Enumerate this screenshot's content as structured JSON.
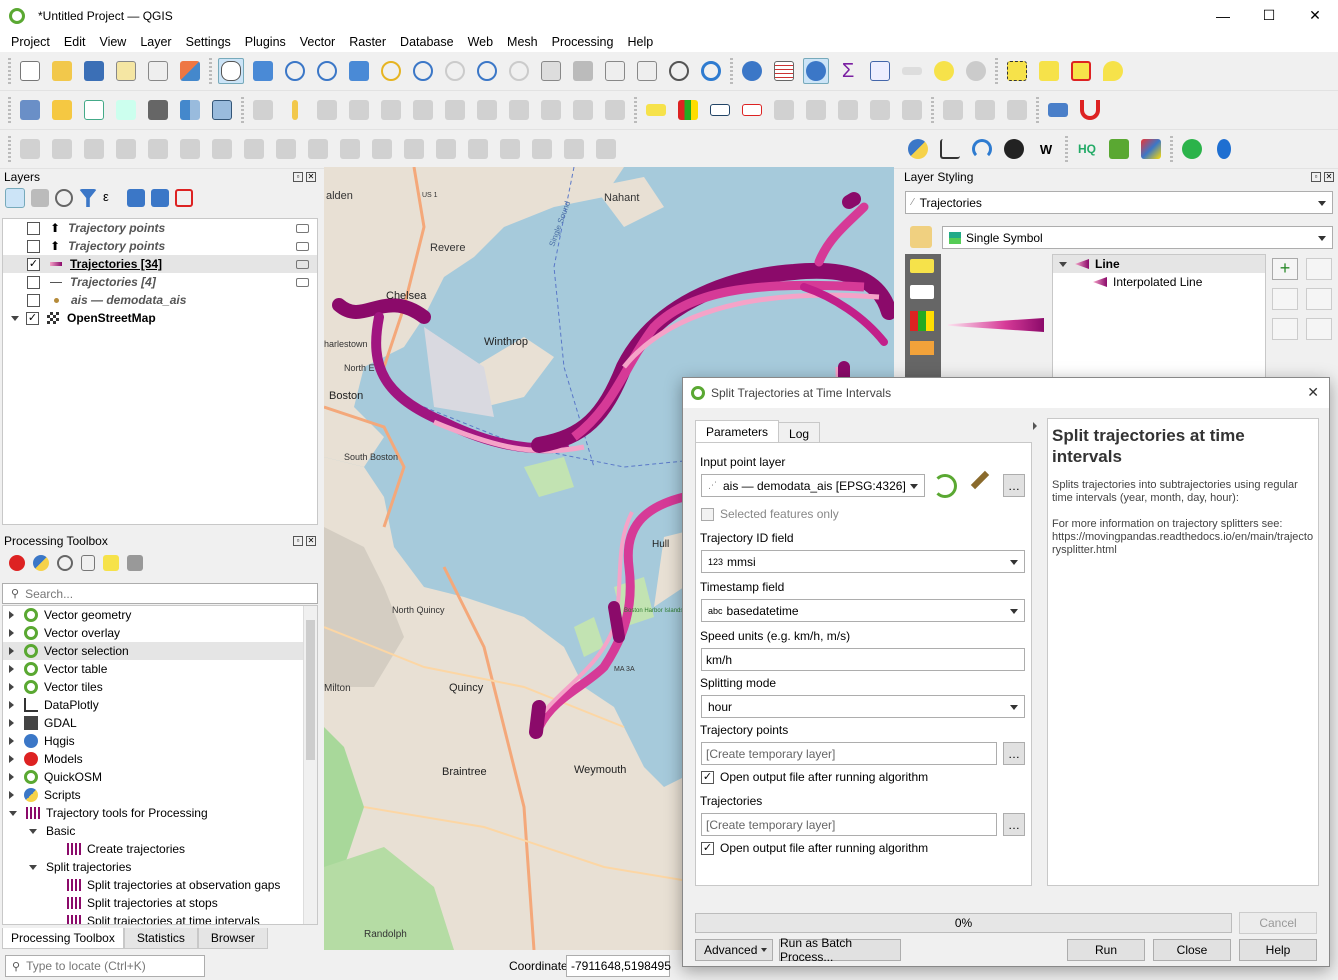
{
  "window": {
    "title": "*Untitled Project — QGIS",
    "minimize": "—",
    "maximize": "☐",
    "close": "✕"
  },
  "menu": [
    "Project",
    "Edit",
    "View",
    "Layer",
    "Settings",
    "Plugins",
    "Vector",
    "Raster",
    "Database",
    "Web",
    "Mesh",
    "Processing",
    "Help"
  ],
  "layers_panel": {
    "title": "Layers",
    "items": [
      {
        "label": "Trajectory points",
        "checked": false,
        "style": "italic"
      },
      {
        "label": "Trajectory points",
        "checked": false,
        "style": "italic"
      },
      {
        "label": "Trajectories [34]",
        "checked": true,
        "style": "boldu"
      },
      {
        "label": "Trajectories [4]",
        "checked": false,
        "style": "italic"
      },
      {
        "label": "ais — demodata_ais",
        "checked": false,
        "style": "italic"
      },
      {
        "label": "OpenStreetMap",
        "checked": true,
        "style": "bold"
      }
    ]
  },
  "toolbox": {
    "title": "Processing Toolbox",
    "search_placeholder": "Search...",
    "items": [
      "Vector geometry",
      "Vector overlay",
      "Vector selection",
      "Vector table",
      "Vector tiles",
      "DataPlotly",
      "GDAL",
      "Hqgis",
      "Models",
      "QuickOSM",
      "Scripts",
      "Trajectory tools for Processing"
    ],
    "basic": "Basic",
    "create": "Create trajectories",
    "split": "Split trajectories",
    "split_items": [
      "Split trajectories at observation gaps",
      "Split trajectories at stops",
      "Split trajectories at time intervals"
    ],
    "tabs": [
      "Processing Toolbox",
      "Statistics",
      "Browser"
    ]
  },
  "locator": {
    "placeholder": "Type to locate (Ctrl+K)"
  },
  "status": {
    "coord_label": "Coordinate",
    "coord_value": "-7911648,5198495"
  },
  "styling": {
    "title": "Layer Styling",
    "layer": "Trajectories",
    "renderer": "Single Symbol",
    "line": "Line",
    "interp": "Interpolated Line"
  },
  "map_labels": {
    "chelsea": "Chelsea",
    "revere": "Revere",
    "winthrop": "Winthrop",
    "boston": "Boston",
    "south_boston": "South Boston",
    "quincy": "Quincy",
    "north_quincy": "North Quincy",
    "milton": "Milton",
    "braintree": "Braintree",
    "weymouth": "Weymouth",
    "randolph": "Randolph",
    "hull": "Hull",
    "nahant": "Nahant",
    "malden": "alden",
    "charlestown": "harlestown",
    "north_end": "North E",
    "single_sound": "Single Sound",
    "islands": "Boston Harbor Islands National Recreation Area",
    "us1": "US 1",
    "ma3a": "MA 3A"
  },
  "dialog": {
    "title": "Split Trajectories at Time Intervals",
    "tab_params": "Parameters",
    "tab_log": "Log",
    "input_label": "Input point layer",
    "input_value": "ais — demodata_ais [EPSG:4326]",
    "selected_only": "Selected features only",
    "traj_id_label": "Trajectory ID field",
    "traj_id_value": "mmsi",
    "traj_id_prefix": "123",
    "ts_label": "Timestamp field",
    "ts_value": "basedatetime",
    "ts_prefix": "abc",
    "speed_label": "Speed units (e.g. km/h, m/s)",
    "speed_value": "km/h",
    "mode_label": "Splitting mode",
    "mode_value": "hour",
    "tp_label": "Trajectory points",
    "tp_value": "[Create temporary layer]",
    "open1": "Open output file after running algorithm",
    "traj_label": "Trajectories",
    "traj_value": "[Create temporary layer]",
    "open2": "Open output file after running algorithm",
    "help_title": "Split trajectories at time intervals",
    "help_p1": "Splits trajectories into subtrajectories using regular time intervals (year, month, day, hour):",
    "help_p2": "For more information on trajectory splitters see:",
    "help_url": "https://movingpandas.readthedocs.io/en/main/trajectorysplitter.html",
    "progress": "0%",
    "progress_value": 0,
    "cancel": "Cancel",
    "advanced": "Advanced",
    "batch": "Run as Batch Process...",
    "run": "Run",
    "close": "Close",
    "help": "Help"
  },
  "colors": {
    "traj_dark": "#8b0a6a",
    "traj_mid": "#d63a97",
    "traj_light": "#f5a3c8",
    "accent": "#5aa832"
  }
}
